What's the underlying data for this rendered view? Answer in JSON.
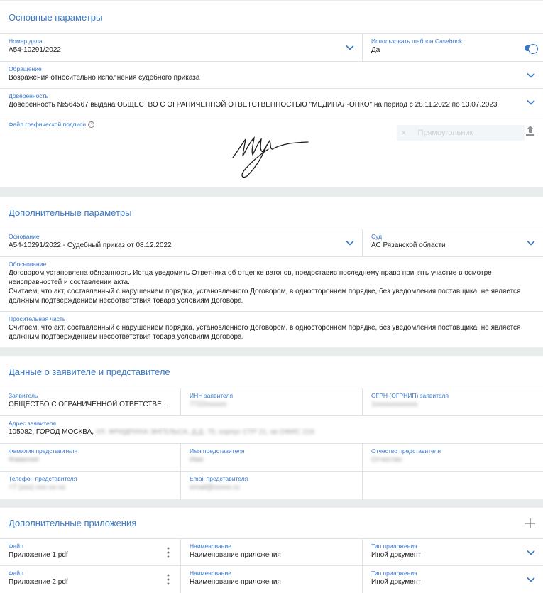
{
  "basic": {
    "title": "Основные параметры",
    "case_number": {
      "label": "Номер дела",
      "value": "А54-10291/2022"
    },
    "template": {
      "label": "Использовать шаблон Casebook",
      "value": "Да"
    },
    "appeal": {
      "label": "Обращение",
      "value": "Возражения относительно исполнения судебного приказа"
    },
    "proxy": {
      "label": "Доверенность",
      "value": "Доверенность №564567 выдана ОБЩЕСТВО С ОГРАНИЧЕННОЙ ОТВЕТСТВЕННОСТЬЮ \"МЕДИПАЛ-ОНКО\" на период с 28.11.2022 по 13.07.2023"
    },
    "signature": {
      "label": "Файл графической подписи",
      "info_icon": "ⓘ",
      "fill_placeholder": "Прямоугольник"
    }
  },
  "additional": {
    "title": "Дополнительные параметры",
    "basis": {
      "label": "Основание",
      "value": "А54-10291/2022 - Судебный приказ от 08.12.2022"
    },
    "court": {
      "label": "Суд",
      "value": "АС Рязанской области"
    },
    "justification": {
      "label": "Обоснование",
      "value": "Договором установлена обязанность Истца уведомить Ответчика об отцепке вагонов, предоставив последнему право принять участие в осмотре неисправностей и составлении акта.\nСчитаем, что акт, составленный с нарушением порядка, установленного Договором, в одностороннем порядке, без уведомления поставщика, не является должным подтверждением несоответствия товара условиям Договора."
    },
    "petition": {
      "label": "Просительная часть",
      "value": "Считаем, что акт, составленный с нарушением порядка, установленного Договором, в одностороннем порядке, без уведомления поставщика, не является должным подтверждением несоответствия товара условиям Договора."
    }
  },
  "applicant": {
    "title": "Данные о заявителе и представителе",
    "applicant": {
      "label": "Заявитель",
      "value": "ОБЩЕСТВО С ОГРАНИЧЕННОЙ ОТВЕТСТВЕННОСТЬЮ \"МЕДИПАЛ-ОНКО\""
    },
    "inn": {
      "label": "ИНН заявителя",
      "value": "7722xxxxxx"
    },
    "ogrn": {
      "label": "ОГРН (ОГРНИП) заявителя",
      "value": "1xxxxxxxxxxxx"
    },
    "address": {
      "label": "Адрес заявителя",
      "value_visible": "105082, ГОРОД МОСКВА,",
      "value_hidden": " УЛ. ФРИДРИХА ЭНГЕЛЬСА, Д.Д. 75, корпус СТР 21, кв ОФИС 216"
    },
    "last_name": {
      "label": "Фамилия представителя",
      "value": "Фамилия"
    },
    "first_name": {
      "label": "Имя представителя",
      "value": "Имя"
    },
    "middle_name": {
      "label": "Отчество представителя",
      "value": "Отчество"
    },
    "phone": {
      "label": "Телефон представителя",
      "value": "+7 (xxx) xxx-xx-xx"
    },
    "email": {
      "label": "Email представителя",
      "value": "email@xxxxx.ru"
    }
  },
  "attachments": {
    "title": "Дополнительные приложения",
    "items": [
      {
        "file_label": "Файл",
        "file": "Приложение 1.pdf",
        "name_label": "Наименование",
        "name": "Наименование приложения",
        "type_label": "Тип приложения",
        "type": "Иной документ"
      },
      {
        "file_label": "Файл",
        "file": "Приложение 2.pdf",
        "name_label": "Наименование",
        "name": "Наименование приложения",
        "type_label": "Тип приложения",
        "type": "Иной документ"
      }
    ]
  },
  "colors": {
    "accent": "#3a78c8",
    "background": "#e8ecec",
    "border": "#dfe3e6"
  }
}
